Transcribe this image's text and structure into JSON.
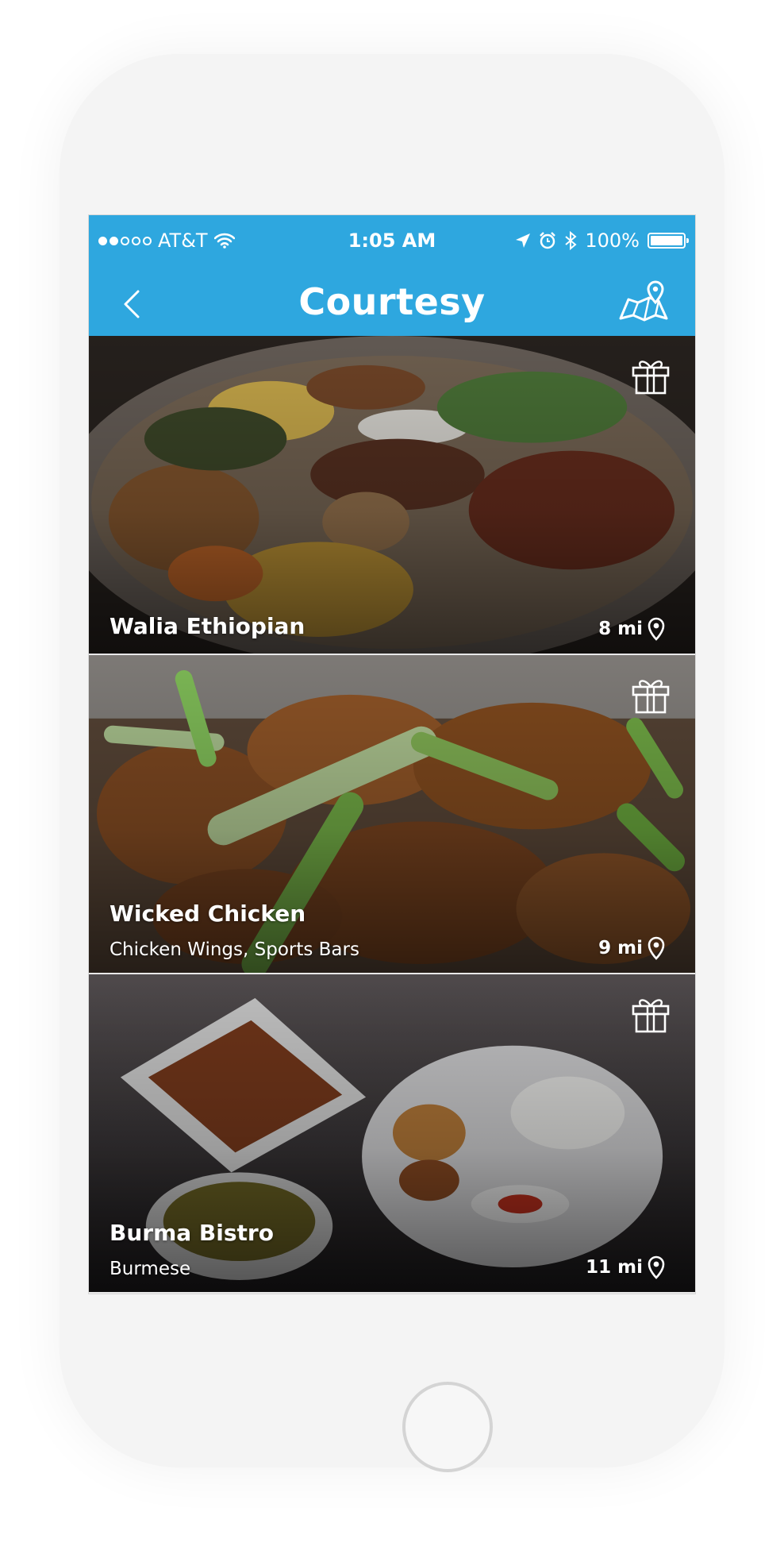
{
  "status_bar": {
    "carrier": "AT&T",
    "time": "1:05 AM",
    "battery": "100%",
    "signal_bars_filled": 2,
    "signal_bars_total": 5
  },
  "navbar": {
    "title": "Courtesy",
    "back_icon": "chevron-left-icon",
    "map_icon": "map-pin-icon"
  },
  "colors": {
    "accent": "#2ea7df",
    "text_on_image": "#ffffff"
  },
  "restaurants": [
    {
      "name": "Walia Ethiopian",
      "categories": "",
      "distance": "8 mi",
      "reward_icon": "gift-icon"
    },
    {
      "name": "Wicked Chicken",
      "categories": "Chicken Wings, Sports Bars",
      "distance": "9 mi",
      "reward_icon": "gift-icon"
    },
    {
      "name": "Burma Bistro",
      "categories": "Burmese",
      "distance": "11 mi",
      "reward_icon": "gift-icon"
    }
  ]
}
